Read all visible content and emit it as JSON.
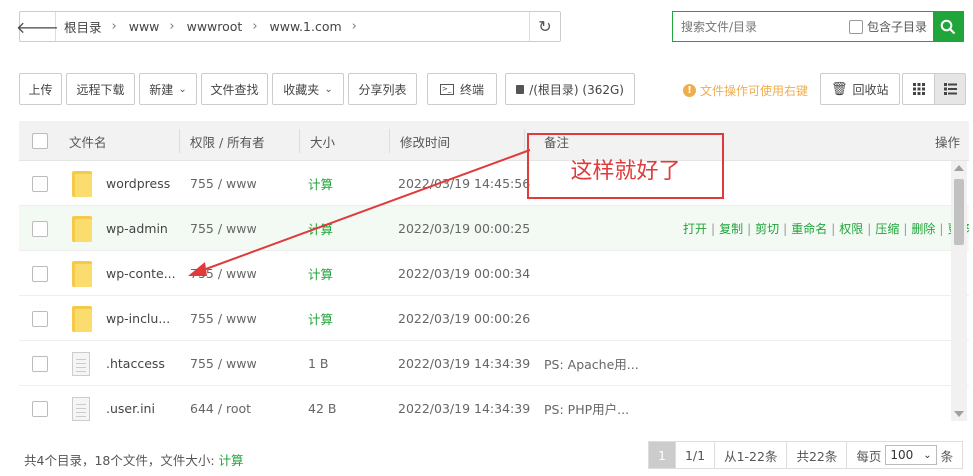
{
  "pathbar": {
    "crumbs": [
      "根目录",
      "www",
      "wwwroot",
      "www.1.com"
    ]
  },
  "search": {
    "placeholder": "搜索文件/目录",
    "subdir_label": "包含子目录"
  },
  "toolbar": {
    "upload": "上传",
    "remote_download": "远程下载",
    "new": "新建",
    "file_search": "文件查找",
    "favorites": "收藏夹",
    "share_list": "分享列表",
    "terminal": "终端",
    "disk": "/(根目录) (362G)",
    "tip": "文件操作可使用右键",
    "recycle": "回收站"
  },
  "table": {
    "headers": {
      "name": "文件名",
      "perm": "权限 / 所有者",
      "size": "大小",
      "mtime": "修改时间",
      "note": "备注",
      "ops": "操作"
    },
    "rows": [
      {
        "name": "wordpress",
        "type": "folder",
        "perm": "755 / www",
        "size": "计算",
        "mtime": "2022/03/19 14:45:56",
        "note": ""
      },
      {
        "name": "wp-admin",
        "type": "folder",
        "perm": "755 / www",
        "size": "计算",
        "mtime": "2022/03/19 00:00:25",
        "note": ""
      },
      {
        "name": "wp-conte...",
        "type": "folder",
        "perm": "755 / www",
        "size": "计算",
        "mtime": "2022/03/19 00:00:34",
        "note": ""
      },
      {
        "name": "wp-inclu...",
        "type": "folder",
        "perm": "755 / www",
        "size": "计算",
        "mtime": "2022/03/19 00:00:26",
        "note": ""
      },
      {
        "name": ".htaccess",
        "type": "file",
        "perm": "755 / www",
        "size": "1 B",
        "mtime": "2022/03/19 14:34:39",
        "note": "PS: Apache用..."
      },
      {
        "name": ".user.ini",
        "type": "file",
        "perm": "644 / root",
        "size": "42 B",
        "mtime": "2022/03/19 14:34:39",
        "note": "PS: PHP用户..."
      }
    ],
    "row_ops": [
      "打开",
      "复制",
      "剪切",
      "重命名",
      "权限",
      "压缩",
      "删除",
      "更多"
    ]
  },
  "annotation": {
    "text": "这样就好了",
    "color": "#e03a3a"
  },
  "footer": {
    "summary_prefix": "共4个目录，18个文件，文件大小: ",
    "summary_calc": "计算",
    "page_current": "1",
    "page_total": "1/1",
    "range": "从1-22条",
    "total": "共22条",
    "per_page_label": "每页",
    "per_page_value": "100",
    "per_page_unit": "条"
  },
  "colors": {
    "accent": "#20a53a",
    "warning": "#f0ad4e",
    "annotation": "#e03a3a"
  }
}
